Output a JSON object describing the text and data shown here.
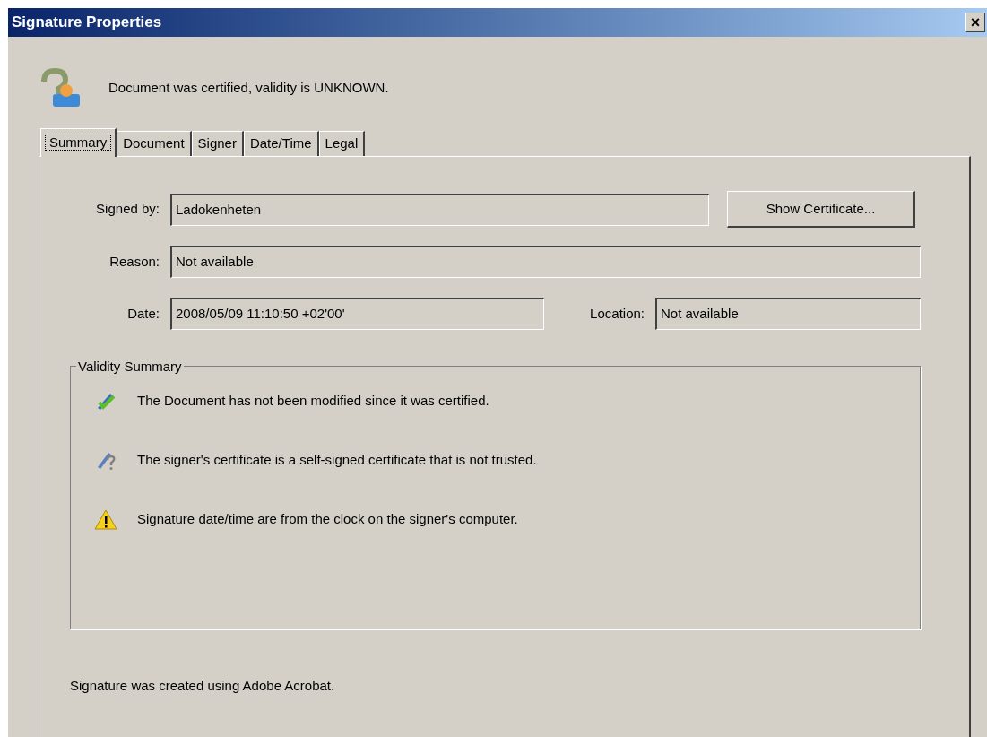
{
  "window": {
    "title": "Signature Properties",
    "close": "×"
  },
  "status_message": "Document was certified, validity is UNKNOWN.",
  "tabs": [
    {
      "label": "Summary",
      "selected": true
    },
    {
      "label": "Document",
      "selected": false
    },
    {
      "label": "Signer",
      "selected": false
    },
    {
      "label": "Date/Time",
      "selected": false
    },
    {
      "label": "Legal",
      "selected": false
    }
  ],
  "fields": {
    "signed_by": {
      "label": "Signed by:",
      "value": "Ladokenheten"
    },
    "reason": {
      "label": "Reason:",
      "value": "Not available"
    },
    "date": {
      "label": "Date:",
      "value": "2008/05/09 11:10:50 +02'00'"
    },
    "location": {
      "label": "Location:",
      "value": "Not available"
    }
  },
  "show_certificate_button": {
    "label": "Show Certificate..."
  },
  "validity_summary": {
    "title": "Validity Summary",
    "items": [
      {
        "kind": "valid",
        "text": "The Document has not been modified since it was certified."
      },
      {
        "kind": "unknown",
        "text": "The signer's certificate is a self-signed certificate that is not trusted."
      },
      {
        "kind": "warning",
        "text": "Signature date/time are from the clock on the signer's computer."
      }
    ]
  },
  "footer": "Signature was created using Adobe Acrobat."
}
